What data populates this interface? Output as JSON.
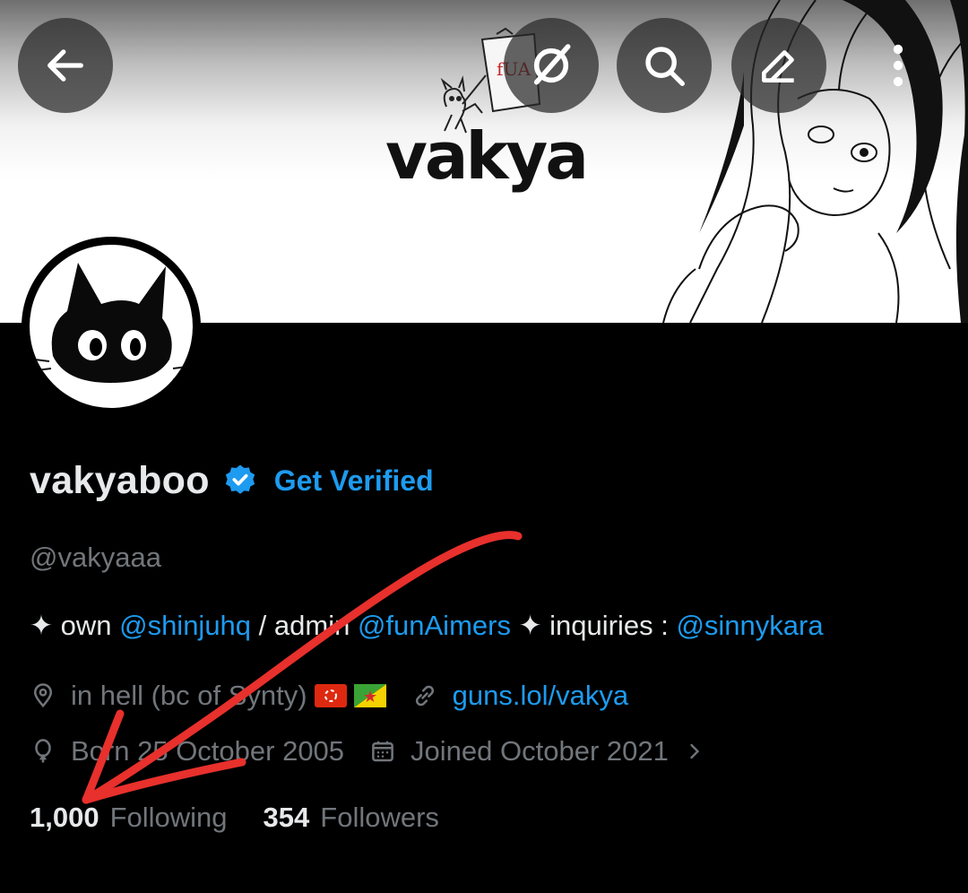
{
  "banner": {
    "logo_text": "vakya",
    "doodle_text": "fUA"
  },
  "nav": {
    "back_icon": "arrow-left-icon",
    "grok_icon": "grok-icon",
    "search_icon": "search-icon",
    "edit_icon": "edit-icon",
    "more_icon": "more-vertical-icon"
  },
  "profile": {
    "display_name": "vakyaboo",
    "verified": true,
    "get_verified_label": "Get Verified",
    "handle": "@vakyaaa",
    "bio": {
      "sparkle_1": "✦",
      "own": " own ",
      "mention_1": "@shinjuhq",
      "slash_admin": " / admin ",
      "mention_2": "@funAimers",
      "sparkle_2": " ✦ ",
      "inquiries": "inquiries : ",
      "mention_3": "@sinnykara"
    },
    "location": "in hell (bc of Synty)",
    "website": "guns.lol/vakya",
    "born": "Born 25 October 2005",
    "joined": "Joined October 2021",
    "following_count": "1,000",
    "following_label": "Following",
    "followers_count": "354",
    "followers_label": "Followers"
  },
  "colors": {
    "accent": "#1d9bf0",
    "muted": "#71767b",
    "annotation": "#e8302c"
  }
}
